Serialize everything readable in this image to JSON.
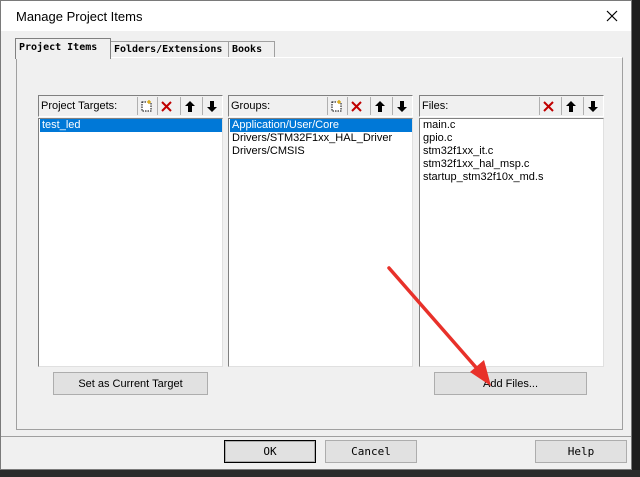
{
  "window": {
    "title": "Manage Project Items"
  },
  "tabs": [
    {
      "label": "Project Items",
      "active": true
    },
    {
      "label": "Folders/Extensions",
      "active": false
    },
    {
      "label": "Books",
      "active": false
    }
  ],
  "targets": {
    "title": "Project Targets:",
    "items": [
      "test_led"
    ],
    "selected_index": 0,
    "button_label": "Set as Current Target"
  },
  "groups": {
    "title": "Groups:",
    "items": [
      "Application/User/Core",
      "Drivers/STM32F1xx_HAL_Driver",
      "Drivers/CMSIS"
    ],
    "selected_index": 0
  },
  "files": {
    "title": "Files:",
    "items": [
      "main.c",
      "gpio.c",
      "stm32f1xx_it.c",
      "stm32f1xx_hal_msp.c",
      "startup_stm32f10x_md.s"
    ],
    "button_label": "Add Files..."
  },
  "footer": {
    "ok_label": "OK",
    "cancel_label": "Cancel",
    "help_label": "Help"
  },
  "colors": {
    "selection": "#0078d7",
    "delete_icon": "#c00000",
    "annotation_arrow": "#e8312a"
  }
}
